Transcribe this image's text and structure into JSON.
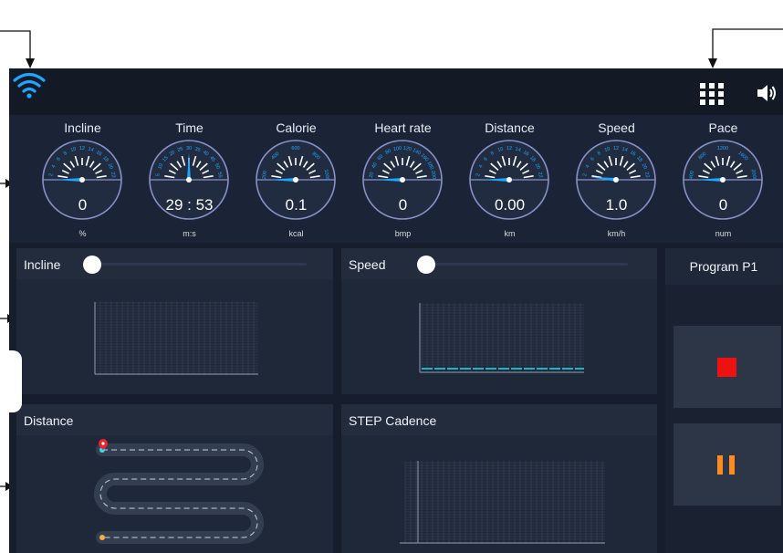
{
  "gauges": [
    {
      "title": "Incline",
      "value": "0",
      "unit": "%",
      "ticks": "2 4 6 8 10 12 14 16 18 20 22"
    },
    {
      "title": "Time",
      "value": "29 : 53",
      "unit": "m:s",
      "ticks": "5 10 15 20 25 30 35 40 45 50 55"
    },
    {
      "title": "Calorie",
      "value": "0.1",
      "unit": "kcal",
      "ticks": "200 400 600 800 1000"
    },
    {
      "title": "Heart rate",
      "value": "0",
      "unit": "bmp",
      "ticks": "20 40 60 80 100 120 140 160 180 200"
    },
    {
      "title": "Distance",
      "value": "0.00",
      "unit": "km",
      "ticks": "2 4 6 8 10 12 14 16 18 20 22"
    },
    {
      "title": "Speed",
      "value": "1.0",
      "unit": "km/h",
      "ticks": "2 4 6 8 10 12 14 16 18 20 22"
    },
    {
      "title": "Pace",
      "value": "0",
      "unit": "num",
      "ticks": "400 800 1200 1600 2000"
    }
  ],
  "panels": {
    "incline": {
      "title": "Incline"
    },
    "speed": {
      "title": "Speed"
    },
    "distance": {
      "title": "Distance"
    },
    "cadence": {
      "title": "STEP Cadence"
    }
  },
  "program": {
    "title": "Program P1"
  },
  "colors": {
    "background": "#161d2b",
    "accent": "#1ea7ff",
    "stop": "#ee1111",
    "pause": "#ff8a1e",
    "speed_line": "#1fb5c9"
  },
  "icons": [
    "wifi-icon",
    "apps-grid-icon",
    "volume-icon",
    "map-pin-icon",
    "stop-icon",
    "pause-icon"
  ]
}
